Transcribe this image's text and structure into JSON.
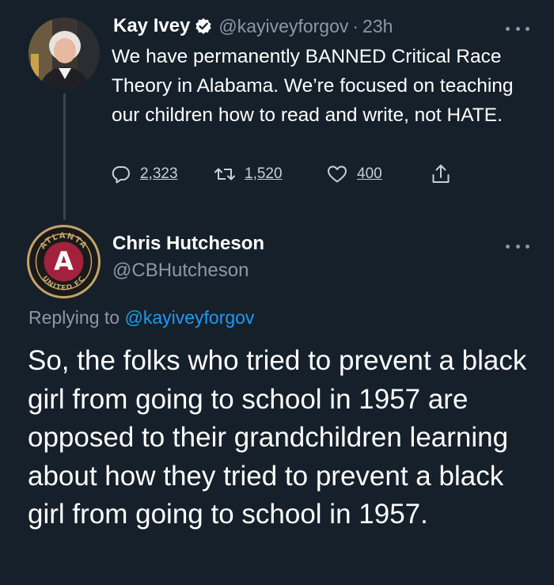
{
  "tweet": {
    "author_name": "Kay Ivey",
    "verified": true,
    "handle": "@kayiveyforgov",
    "separator": "·",
    "time": "23h",
    "text": "We have permanently BANNED Critical Race Theory in Alabama. We’re focused on teaching our children how to read and write, not HATE.",
    "replies": "2,323",
    "retweets": "1,520",
    "likes": "400",
    "icons": {
      "more": "more-horizontal-icon",
      "reply": "reply-icon",
      "retweet": "retweet-icon",
      "like": "heart-icon",
      "share": "share-icon",
      "verified": "verified-badge-icon"
    }
  },
  "reply": {
    "author_name": "Chris Hutcheson",
    "handle": "@CBHutcheson",
    "replying_to_label": "Replying to",
    "replying_to_handle": "@kayiveyforgov",
    "text": "So, the folks who tried to prevent a black girl from going to school in 1957 are opposed to their grandchildren learning about how they tried to prevent a black girl from going to school in 1957.",
    "avatar_logo_top": "ATLANTA",
    "avatar_logo_bottom": "UNITED FC",
    "avatar_logo_letter": "A"
  },
  "colors": {
    "background": "#15202b",
    "text_primary": "#ffffff",
    "text_secondary": "#8b98a5",
    "accent": "#1d9bf0",
    "thread_line": "#38444d"
  }
}
